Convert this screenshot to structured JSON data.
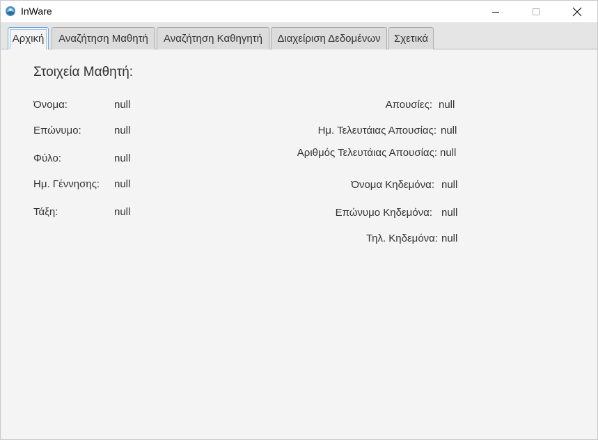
{
  "window": {
    "title": "InWare",
    "app_icon": "inware-logo-icon"
  },
  "tabs": [
    {
      "label": "Αρχική",
      "active": true
    },
    {
      "label": "Αναζήτηση Μαθητή",
      "active": false
    },
    {
      "label": "Αναζήτηση Καθηγητή",
      "active": false
    },
    {
      "label": "Διαχείριση Δεδομένων",
      "active": false
    },
    {
      "label": "Σχετικά",
      "active": false
    }
  ],
  "student": {
    "heading": "Στοιχεία Μαθητή:",
    "first_name": {
      "label": "Όνομα:",
      "value": "null"
    },
    "last_name": {
      "label": "Επώνυμο:",
      "value": "null"
    },
    "gender": {
      "label": "Φύλο:",
      "value": "null"
    },
    "birth_date": {
      "label": "Ημ. Γέννησης:",
      "value": "null"
    },
    "class": {
      "label": "Τάξη:",
      "value": "null"
    },
    "absences": {
      "label": "Απουσίες:",
      "value": "null"
    },
    "last_absence_date": {
      "label": "Ημ. Τελευτάιας Απουσίας:",
      "value": "null"
    },
    "last_absence_number": {
      "label": "Αριθμός Τελευτάιας Απουσίας:",
      "value": "null"
    },
    "guardian_first_name": {
      "label": "Όνομα Κηδεμόνα:",
      "value": "null"
    },
    "guardian_last_name": {
      "label": "Επώνυμο Κηδεμόνα:",
      "value": "null"
    },
    "guardian_phone": {
      "label": "Τηλ. Κηδεμόνα:",
      "value": "null"
    }
  }
}
